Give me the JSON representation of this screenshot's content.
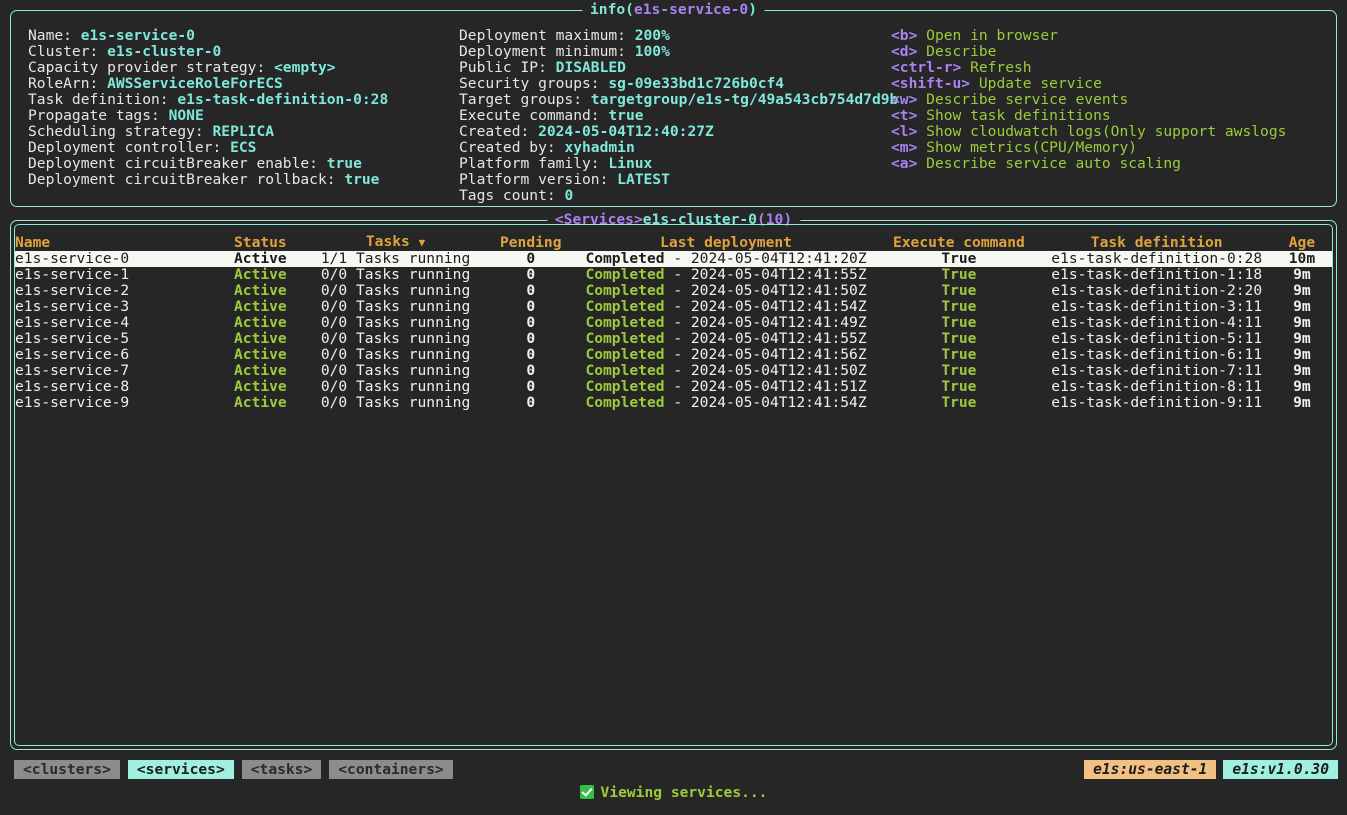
{
  "info_panel": {
    "title_prefix": "info(",
    "title_name": "e1s-service-0",
    "title_suffix": ")",
    "column1": [
      {
        "label": "Name:",
        "value": "e1s-service-0"
      },
      {
        "label": "Cluster:",
        "value": "e1s-cluster-0"
      },
      {
        "label": "Capacity provider strategy:",
        "value": "<empty>"
      },
      {
        "label": "RoleArn:",
        "value": "AWSServiceRoleForECS"
      },
      {
        "label": "Task definition:",
        "value": "e1s-task-definition-0:28"
      },
      {
        "label": "Propagate tags:",
        "value": "NONE"
      },
      {
        "label": "Scheduling strategy:",
        "value": "REPLICA"
      },
      {
        "label": "Deployment controller:",
        "value": "ECS"
      },
      {
        "label": "Deployment circuitBreaker enable:",
        "value": "true"
      },
      {
        "label": "Deployment circuitBreaker rollback:",
        "value": "true"
      }
    ],
    "column2": [
      {
        "label": "Deployment maximum:",
        "value": "200%"
      },
      {
        "label": "Deployment minimum:",
        "value": "100%"
      },
      {
        "label": "Public IP:",
        "value": "DISABLED"
      },
      {
        "label": "Security groups:",
        "value": "sg-09e33bd1c726b0cf4"
      },
      {
        "label": "Target groups:",
        "value": "targetgroup/e1s-tg/49a543cb754d7d9b"
      },
      {
        "label": "Execute command:",
        "value": "true"
      },
      {
        "label": "Created:",
        "value": "2024-05-04T12:40:27Z"
      },
      {
        "label": "Created by:",
        "value": "xyhadmin"
      },
      {
        "label": "Platform family:",
        "value": "Linux"
      },
      {
        "label": "Platform version:",
        "value": "LATEST"
      },
      {
        "label": "Tags count:",
        "value": "0"
      }
    ],
    "shortcuts": [
      {
        "key": "<b>",
        "action": "Open in browser"
      },
      {
        "key": "<d>",
        "action": "Describe"
      },
      {
        "key": "<ctrl-r>",
        "action": "Refresh"
      },
      {
        "key": "<shift-u>",
        "action": "Update service"
      },
      {
        "key": "<w>",
        "action": "Describe service events"
      },
      {
        "key": "<t>",
        "action": "Show task definitions"
      },
      {
        "key": "<l>",
        "action": "Show cloudwatch logs(Only support awslogs"
      },
      {
        "key": "<m>",
        "action": "Show metrics(CPU/Memory)"
      },
      {
        "key": "<a>",
        "action": "Describe service auto scaling"
      }
    ]
  },
  "services_panel": {
    "title_prefix": "<Services>",
    "title_name": "e1s-cluster-0",
    "title_count": "(10)",
    "headers": {
      "name": "Name",
      "status": "Status",
      "tasks": "Tasks",
      "tasks_sort": "▼",
      "pending": "Pending",
      "last_deployment": "Last deployment",
      "execute_command": "Execute command",
      "task_definition": "Task definition",
      "age": "Age"
    },
    "rows": [
      {
        "name": "e1s-service-0",
        "status": "Active",
        "tasks": "1/1 Tasks running",
        "pending": "0",
        "dep_state": "Completed",
        "dep_sep": " - ",
        "dep_time": "2024-05-04T12:41:20Z",
        "execute_command": "True",
        "task_definition": "e1s-task-definition-0:28",
        "age": "10m",
        "selected": true
      },
      {
        "name": "e1s-service-1",
        "status": "Active",
        "tasks": "0/0 Tasks running",
        "pending": "0",
        "dep_state": "Completed",
        "dep_sep": " - ",
        "dep_time": "2024-05-04T12:41:55Z",
        "execute_command": "True",
        "task_definition": "e1s-task-definition-1:18",
        "age": "9m",
        "selected": false
      },
      {
        "name": "e1s-service-2",
        "status": "Active",
        "tasks": "0/0 Tasks running",
        "pending": "0",
        "dep_state": "Completed",
        "dep_sep": " - ",
        "dep_time": "2024-05-04T12:41:50Z",
        "execute_command": "True",
        "task_definition": "e1s-task-definition-2:20",
        "age": "9m",
        "selected": false
      },
      {
        "name": "e1s-service-3",
        "status": "Active",
        "tasks": "0/0 Tasks running",
        "pending": "0",
        "dep_state": "Completed",
        "dep_sep": " - ",
        "dep_time": "2024-05-04T12:41:54Z",
        "execute_command": "True",
        "task_definition": "e1s-task-definition-3:11",
        "age": "9m",
        "selected": false
      },
      {
        "name": "e1s-service-4",
        "status": "Active",
        "tasks": "0/0 Tasks running",
        "pending": "0",
        "dep_state": "Completed",
        "dep_sep": " - ",
        "dep_time": "2024-05-04T12:41:49Z",
        "execute_command": "True",
        "task_definition": "e1s-task-definition-4:11",
        "age": "9m",
        "selected": false
      },
      {
        "name": "e1s-service-5",
        "status": "Active",
        "tasks": "0/0 Tasks running",
        "pending": "0",
        "dep_state": "Completed",
        "dep_sep": " - ",
        "dep_time": "2024-05-04T12:41:55Z",
        "execute_command": "True",
        "task_definition": "e1s-task-definition-5:11",
        "age": "9m",
        "selected": false
      },
      {
        "name": "e1s-service-6",
        "status": "Active",
        "tasks": "0/0 Tasks running",
        "pending": "0",
        "dep_state": "Completed",
        "dep_sep": " - ",
        "dep_time": "2024-05-04T12:41:56Z",
        "execute_command": "True",
        "task_definition": "e1s-task-definition-6:11",
        "age": "9m",
        "selected": false
      },
      {
        "name": "e1s-service-7",
        "status": "Active",
        "tasks": "0/0 Tasks running",
        "pending": "0",
        "dep_state": "Completed",
        "dep_sep": " - ",
        "dep_time": "2024-05-04T12:41:50Z",
        "execute_command": "True",
        "task_definition": "e1s-task-definition-7:11",
        "age": "9m",
        "selected": false
      },
      {
        "name": "e1s-service-8",
        "status": "Active",
        "tasks": "0/0 Tasks running",
        "pending": "0",
        "dep_state": "Completed",
        "dep_sep": " - ",
        "dep_time": "2024-05-04T12:41:51Z",
        "execute_command": "True",
        "task_definition": "e1s-task-definition-8:11",
        "age": "9m",
        "selected": false
      },
      {
        "name": "e1s-service-9",
        "status": "Active",
        "tasks": "0/0 Tasks running",
        "pending": "0",
        "dep_state": "Completed",
        "dep_sep": " - ",
        "dep_time": "2024-05-04T12:41:54Z",
        "execute_command": "True",
        "task_definition": "e1s-task-definition-9:11",
        "age": "9m",
        "selected": false
      }
    ]
  },
  "bottom_bar": {
    "tabs": [
      {
        "label": "<clusters>",
        "active": false
      },
      {
        "label": "<services>",
        "active": true
      },
      {
        "label": "<tasks>",
        "active": false
      },
      {
        "label": "<containers>",
        "active": false
      }
    ],
    "badges": {
      "region": "e1s:us-east-1",
      "version": "e1s:v1.0.30"
    }
  },
  "status": {
    "icon": "check-mark-button",
    "text": "Viewing services..."
  },
  "colors": {
    "background": "#262626",
    "border": "#8fe8d8",
    "accent_cyan": "#7fe8d8",
    "accent_purple": "#a783f0",
    "accent_green": "#9ccc3c",
    "accent_orange": "#e0a33c",
    "selected_row": "#f7f7f2",
    "badge_region": "#f2c083",
    "badge_version": "#9ff0de"
  }
}
